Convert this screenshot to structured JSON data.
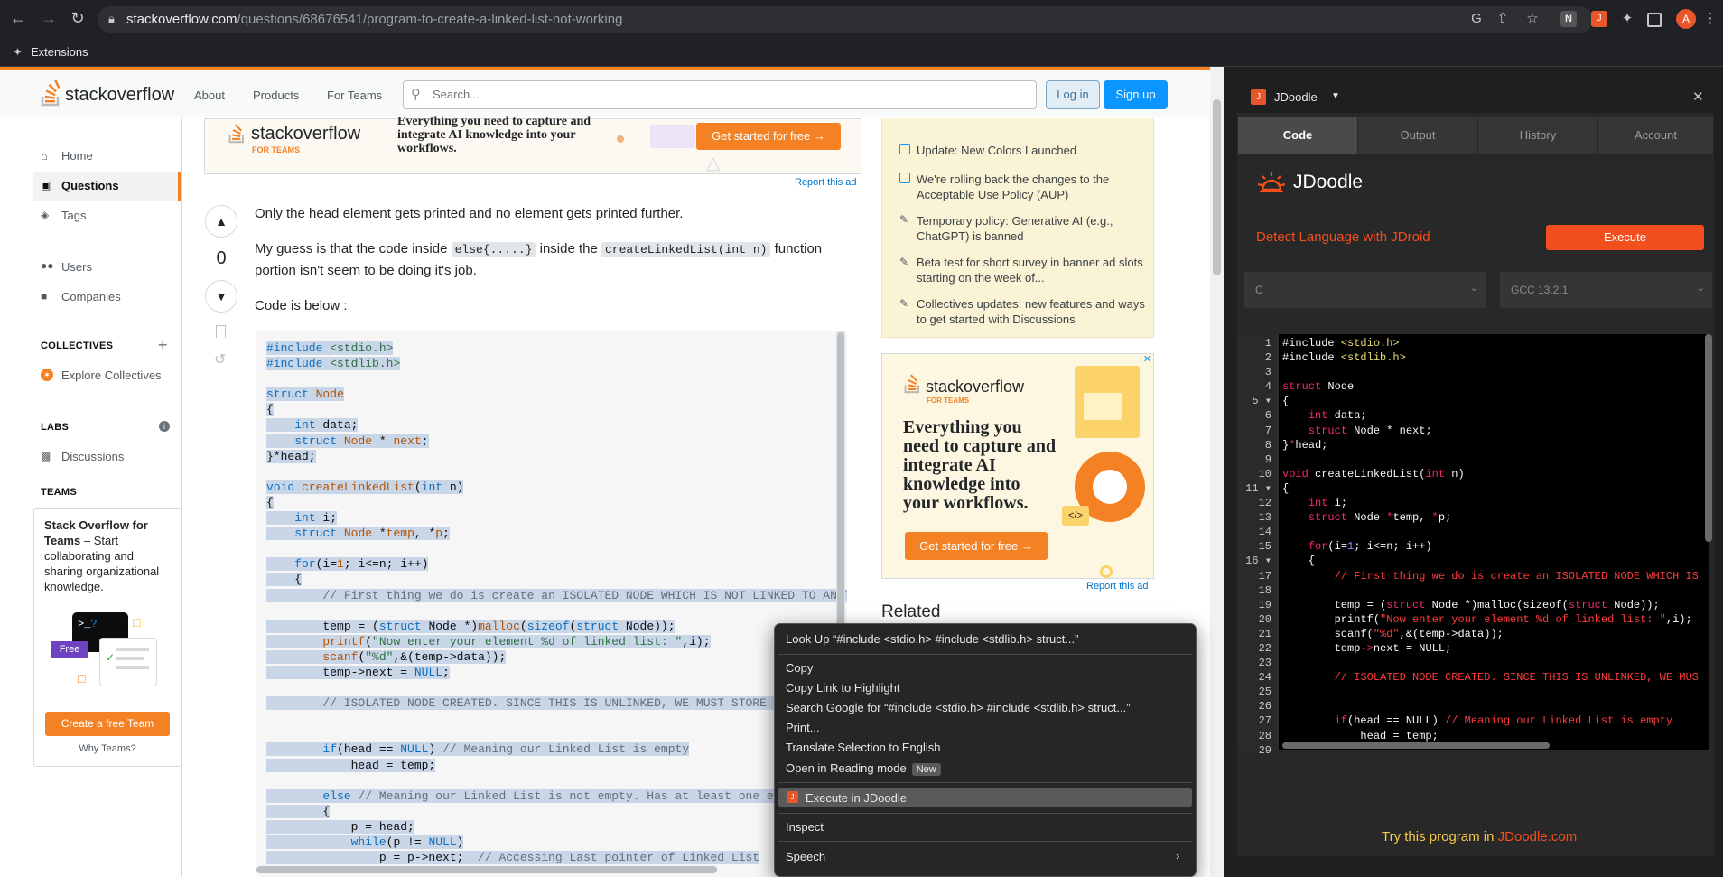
{
  "browser": {
    "url_domain": "stackoverflow.com",
    "url_path": "/questions/68676541/program-to-create-a-linked-list-not-working",
    "extensions_label": "Extensions",
    "profile_initial": "A"
  },
  "so": {
    "logo_text": "stackoverflow",
    "nav": [
      "About",
      "Products",
      "For Teams"
    ],
    "search_placeholder": "Search...",
    "login": "Log in",
    "signup": "Sign up",
    "sidebar": {
      "home": "Home",
      "questions": "Questions",
      "tags": "Tags",
      "users": "Users",
      "companies": "Companies",
      "collectives_head": "COLLECTIVES",
      "explore_collectives": "Explore Collectives",
      "labs_head": "LABS",
      "discussions": "Discussions",
      "teams_head": "TEAMS",
      "teams_title": "Stack Overflow for Teams",
      "teams_desc": " – Start collaborating and sharing organizational knowledge.",
      "free_badge": "Free",
      "create_team": "Create a free Team",
      "why_teams": "Why Teams?"
    },
    "ad_top": {
      "brand": "stackoverflow",
      "brand_sub": "FOR TEAMS",
      "text": "Everything you need to capture and integrate AI knowledge into your workflows.",
      "cta": "Get started for free →",
      "report": "Report this ad"
    },
    "vote_count": "0",
    "question": {
      "p1": "Only the head element gets printed and no element gets printed further.",
      "p2_a": "My guess is that the code inside ",
      "p2_code1": "else{.....}",
      "p2_b": " inside the ",
      "p2_code2": "createLinkedList(int n)",
      "p2_c": " function",
      "p2_d": "portion isn't seem to be doing it's job.",
      "p3": "Code is below :"
    },
    "blog": [
      "Update: New Colors Launched",
      "We're rolling back the changes to the Acceptable Use Policy (AUP)",
      "Temporary policy: Generative AI (e.g., ChatGPT) is banned",
      "Beta test for short survey in banner ad slots starting on the week of...",
      "Collectives updates: new features and ways to get started with Discussions"
    ],
    "ad_side": {
      "brand": "stackoverflow",
      "brand_sub": "FOR TEAMS",
      "text": "Everything you need to capture and integrate AI knowledge into your workflows.",
      "cta": "Get started for free →",
      "report": "Report this ad"
    },
    "related": "Related"
  },
  "jdoodle": {
    "ext_name": "JDoodle",
    "tabs": [
      "Code",
      "Output",
      "History",
      "Account"
    ],
    "active_tab": "Code",
    "brand": "JDoodle",
    "detect": "Detect Language with JDroid",
    "execute": "Execute",
    "language": "C",
    "compiler": "GCC 13.2.1",
    "try_prefix": "Try this program in ",
    "try_link": "JDoodle.com"
  },
  "context_menu": {
    "lookup": "Look Up “#include <stdio.h> #include <stdlib.h>  struct...”",
    "copy": "Copy",
    "copy_link": "Copy Link to Highlight",
    "search_google": "Search Google for “#include <stdio.h> #include <stdlib.h>  struct...”",
    "print": "Print...",
    "translate": "Translate Selection to English",
    "reading_mode": "Open in Reading mode",
    "new_badge": "New",
    "execute_jdoodle": "Execute in JDoodle",
    "inspect": "Inspect",
    "speech": "Speech"
  },
  "colors": {
    "so_orange": "#f48225",
    "so_blue": "#0a95ff",
    "jd_orange": "#f24f1f",
    "chrome_dark": "#202124"
  }
}
